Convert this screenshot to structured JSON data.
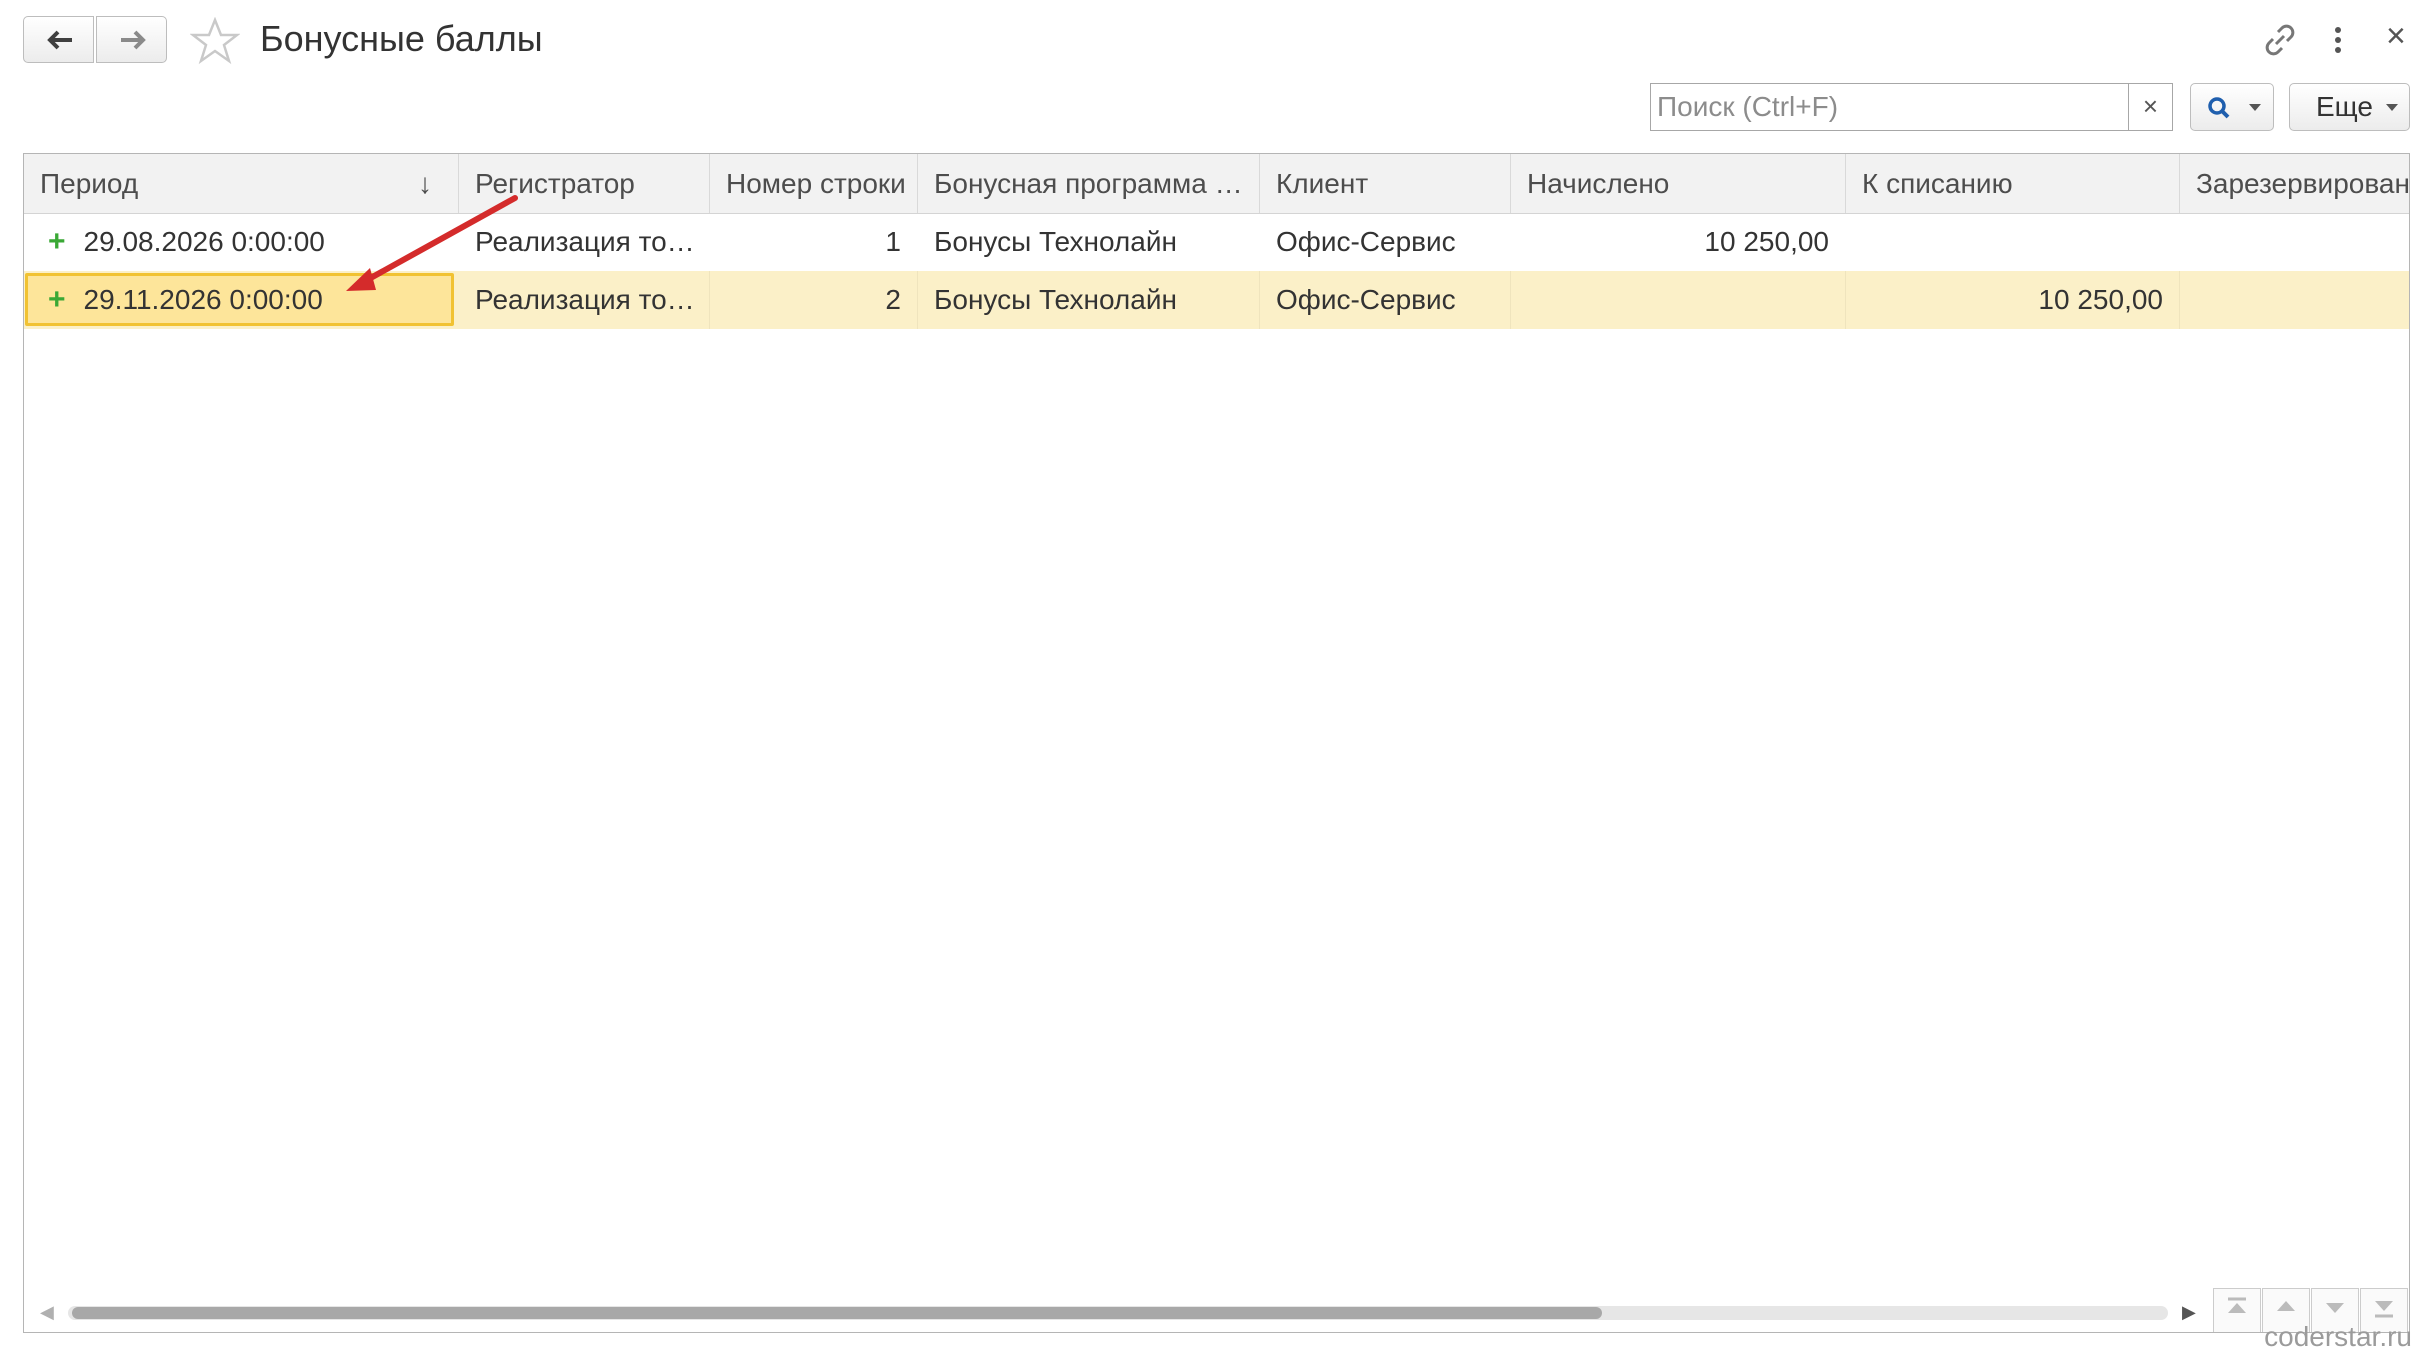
{
  "header": {
    "title": "Бонусные баллы",
    "back_icon": "arrow-left-icon",
    "forward_icon": "arrow-right-icon",
    "favorite_icon": "star-icon",
    "link_icon": "link-icon",
    "menu_icon": "kebab-menu-icon",
    "close_label": "×"
  },
  "toolbar": {
    "search_placeholder": "Поиск (Ctrl+F)",
    "search_clear": "×",
    "search_icon": "magnifier-icon",
    "more_label": "Еще"
  },
  "table": {
    "columns": [
      {
        "label": "Период",
        "sort": "↓"
      },
      {
        "label": "Регистратор"
      },
      {
        "label": "Номер строки"
      },
      {
        "label": "Бонусная программа …"
      },
      {
        "label": "Клиент"
      },
      {
        "label": "Начислено"
      },
      {
        "label": "К списанию"
      },
      {
        "label": "Зарезервировано"
      }
    ],
    "rows": [
      {
        "marker": "+",
        "period": "29.08.2026 0:00:00",
        "registrar": "Реализация то…",
        "line_no": "1",
        "program": "Бонусы Технолайн",
        "client": "Офис-Сервис",
        "accrued": "10 250,00",
        "to_write_off": "",
        "reserved": ""
      },
      {
        "marker": "+",
        "period": "29.11.2026 0:00:00",
        "registrar": "Реализация то…",
        "line_no": "2",
        "program": "Бонусы Технолайн",
        "client": "Офис-Сервис",
        "accrued": "",
        "to_write_off": "10 250,00",
        "reserved": ""
      }
    ],
    "selected_row": 2
  },
  "footer": {
    "watermark": "coderstar.ru"
  },
  "colors": {
    "selected_row": "#fbf0c8",
    "current_cell": "#fde59a",
    "current_cell_border": "#f1c232",
    "plus_marker": "#3aa835",
    "annotation_arrow": "#d42b2b"
  }
}
